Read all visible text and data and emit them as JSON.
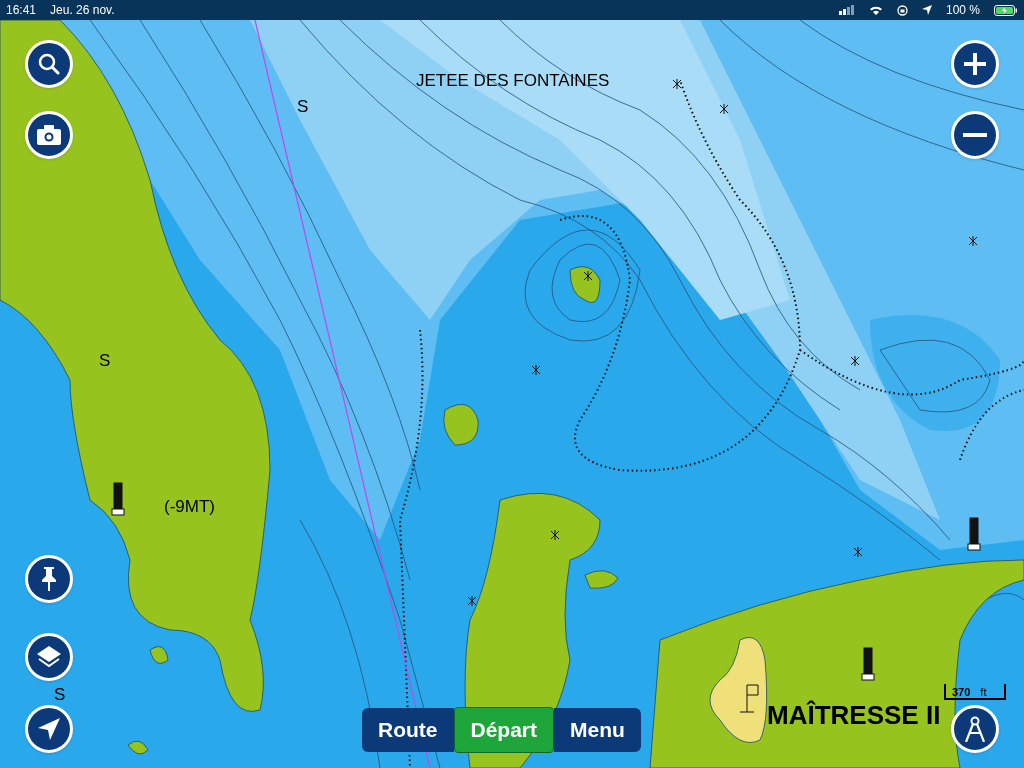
{
  "status_bar": {
    "time": "16:41",
    "date": "Jeu. 26 nov.",
    "battery_text": "100 %"
  },
  "map_labels": [
    {
      "text": "JETEE DES FONTAINES",
      "kind": "place"
    },
    {
      "text": "S",
      "kind": "place"
    },
    {
      "text": "S",
      "kind": "place"
    },
    {
      "text": "(-9MT)",
      "kind": "place"
    },
    {
      "text": "S",
      "kind": "place"
    },
    {
      "text": "MAÎTRESSE II",
      "kind": "title"
    }
  ],
  "scale": {
    "value": "370",
    "unit": "ft"
  },
  "bottom_bar": [
    {
      "label": "Route",
      "selected": false
    },
    {
      "label": "Départ",
      "selected": true
    },
    {
      "label": "Menu",
      "selected": false
    }
  ]
}
